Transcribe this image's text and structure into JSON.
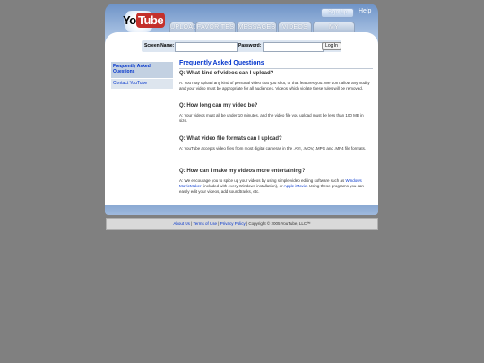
{
  "header": {
    "logo_you": "You",
    "logo_tube": "Tube",
    "signup_label": "Sign Up",
    "help_label": "Help",
    "tabs": [
      {
        "label": "UPLOAD"
      },
      {
        "label": "FAVORITES"
      },
      {
        "label": "MESSAGES"
      },
      {
        "label": "VIDEOS"
      },
      {
        "label": "MY PROFILE"
      }
    ]
  },
  "login": {
    "screen_name_label": "Screen Name:",
    "screen_name_value": "",
    "password_label": "Password:",
    "password_value": "",
    "login_button": "Log In"
  },
  "sidebar": {
    "items": [
      {
        "label": "Frequently Asked Questions"
      },
      {
        "label": "Contact YouTube"
      }
    ]
  },
  "main": {
    "title": "Frequently Asked Questions",
    "faqs": [
      {
        "question": "Q: What kind of videos can I upload?",
        "answer": "A: You may upload any kind of personal video that you shot, or that features you. We don't allow any nudity and your video must be appropriate for all audiences. Videos which violate these rules will be removed."
      },
      {
        "question": "Q: How long can my video be?",
        "answer": "A: Your videos must all be under 10 minutes, and the video file you upload must be less than 100 MB in size."
      },
      {
        "question": "Q: What video file formats can I upload?",
        "answer": "A: YouTube accepts video files from most digital cameras in the .AVI, .MOV, .MPG and .MP4 file formats."
      },
      {
        "question": "Q: How can I make my videos more entertaining?",
        "answer_pre": "A: We encourage you to spice up your videos by using simple video editing software such as",
        "answer_link1": "Windows MovieMaker",
        "answer_mid": "(included with every Windows installation), or",
        "answer_link2": "Apple iMovie",
        "answer_post": ". Using these programs you can easily edit your videos, add soundtracks, etc."
      }
    ]
  },
  "footer": {
    "about": "About Us",
    "sep1": "|",
    "terms": "Terms of Use",
    "sep2": "|",
    "privacy": "Privacy Policy",
    "copyright": "| Copyright © 2005 YouTube, LLC™"
  }
}
